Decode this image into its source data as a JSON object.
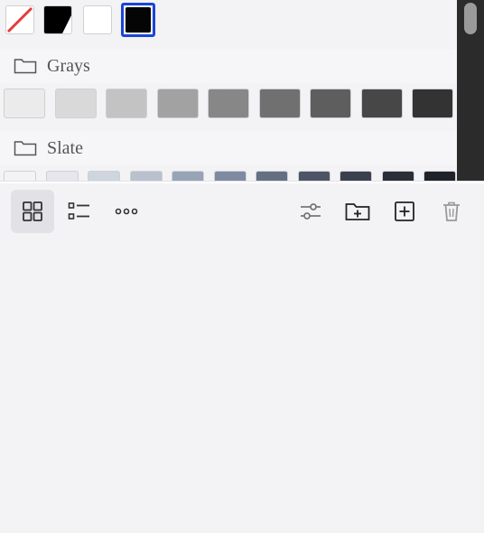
{
  "top_swatches": [
    {
      "kind": "none",
      "border": "#cfcfd4",
      "fill": "#ffffff",
      "accent": "#e23b3b"
    },
    {
      "kind": "split",
      "border": "#cfcfd4",
      "fill": "#000000"
    },
    {
      "kind": "solid",
      "border": "#cfcfd4",
      "fill": "#ffffff"
    },
    {
      "kind": "selected",
      "border": "#1a45d6",
      "fill": "#050505"
    }
  ],
  "groups": [
    {
      "label": "Grays",
      "colors": [
        "#ebebeb",
        "#d9d9d9",
        "#c3c3c3",
        "#a2a2a2",
        "#878787",
        "#707070",
        "#5e5e5e",
        "#474747",
        "#333333"
      ]
    },
    {
      "label": "Slate",
      "colors": [
        "#f3f3f5",
        "#e5e7ec",
        "#cfd5dd",
        "#b8c1cd",
        "#97a3b6",
        "#7d8aa1",
        "#646f84",
        "#4c5565",
        "#3a404d",
        "#2a2e37",
        "#1d2128"
      ]
    }
  ],
  "toolbar": {
    "left": [
      {
        "name": "grid-view-icon",
        "active": true
      },
      {
        "name": "list-view-icon",
        "active": false
      },
      {
        "name": "more-options-icon",
        "active": false
      }
    ],
    "right": [
      {
        "name": "adjustments-icon"
      },
      {
        "name": "new-folder-icon"
      },
      {
        "name": "add-swatch-icon"
      },
      {
        "name": "delete-icon"
      }
    ]
  },
  "colors": {
    "panel_bg": "#f3f3f6",
    "icon": "#333333",
    "icon_muted": "#999999",
    "selected_border": "#1a45d6"
  }
}
